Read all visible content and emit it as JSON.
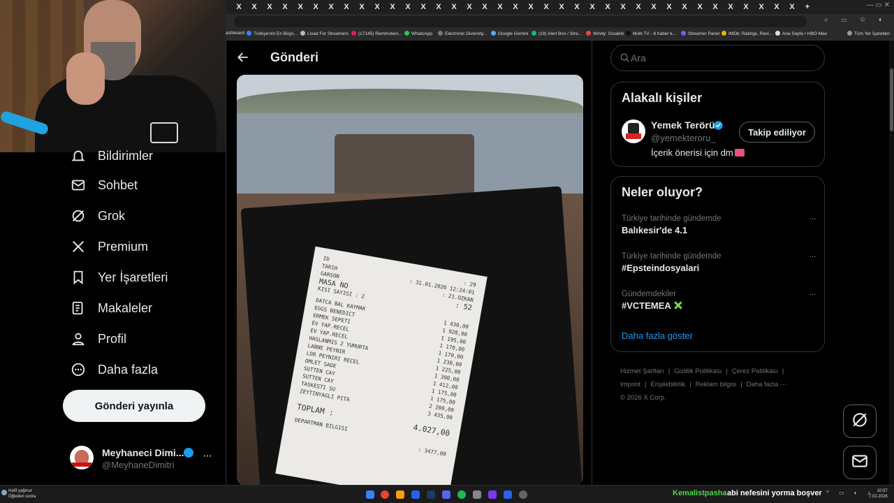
{
  "browser": {
    "tab_close_glyph": "X",
    "bookmarks": [
      {
        "label": "ashboard",
        "color": "#888"
      },
      {
        "label": "Türkiye'nin En Büyü...",
        "color": "#3b82f6"
      },
      {
        "label": "Livad For Streamers",
        "color": "#bbb"
      },
      {
        "label": "(17145) Rammstein...",
        "color": "#e11d48"
      },
      {
        "label": "WhatsApp",
        "color": "#22c55e"
      },
      {
        "label": "Electronic Diversity...",
        "color": "#777"
      },
      {
        "label": "Google Gemini",
        "color": "#60a5fa"
      },
      {
        "label": "(19) Alert Box / Stre...",
        "color": "#10b981"
      },
      {
        "label": "Windy: Sıcaklık",
        "color": "#ef4444"
      },
      {
        "label": "Multi TV - 6 haber k...",
        "color": "#111"
      },
      {
        "label": "Streamer Panel",
        "color": "#6366f1"
      },
      {
        "label": "IMDb: Ratings, Revi...",
        "color": "#eab308"
      },
      {
        "label": "Ana Sayfa • HBO Max",
        "color": "#ddd"
      },
      {
        "label": "Tüm Yer İşaretleri",
        "color": "#999"
      }
    ]
  },
  "nav": {
    "items": [
      {
        "label": "Bildirimler",
        "icon": "bell-icon"
      },
      {
        "label": "Sohbet",
        "icon": "mail-icon"
      },
      {
        "label": "Grok",
        "icon": "grok-icon"
      },
      {
        "label": "Premium",
        "icon": "x-logo-icon"
      },
      {
        "label": "Yer İşaretleri",
        "icon": "bookmark-icon"
      },
      {
        "label": "Makaleler",
        "icon": "article-icon"
      },
      {
        "label": "Profil",
        "icon": "profile-icon"
      },
      {
        "label": "Daha fazla",
        "icon": "more-circle-icon"
      }
    ],
    "post_button": "Gönderi yayınla",
    "account": {
      "name": "Meyhaneci Dimi...",
      "handle": "@MeyhaneDimitri",
      "more": "···",
      "avatar_text": "DIMITR"
    }
  },
  "main": {
    "title": "Gönderi",
    "receipt": {
      "header": [
        [
          "ID",
          ": 29"
        ],
        [
          "TARIH",
          ": 31.01.2026 12:24:01"
        ],
        [
          "GARSON",
          ": 21.OZKAN"
        ],
        [
          "MASA NO",
          ": 52"
        ],
        [
          "KISI SAYISI : 2",
          ""
        ]
      ],
      "items": [
        [
          "DATCA BAL KAYMAK",
          "1  430,00"
        ],
        [
          "EGGS BENEDICT",
          "1  920,00"
        ],
        [
          "ERMEK SEPETI",
          "1  195,00"
        ],
        [
          "EV YAP.RECEL",
          "1  170,00"
        ],
        [
          "EV YAP.RECEL",
          "1  170,00"
        ],
        [
          "HASLANMIS 2 YUMURTA",
          "1  230,00"
        ],
        [
          "LABNE PEYNIR",
          "1  225,00"
        ],
        [
          "LOR PEYNIRI RECEL",
          "1  390,00"
        ],
        [
          "OMLET SADE",
          "1  412,00"
        ],
        [
          "SUTTEN CAY",
          "1  175,00"
        ],
        [
          "SUTTEN CAY",
          "1  175,00"
        ],
        [
          "TASKESTI SU",
          "2  200,00"
        ],
        [
          "ZEYTINYAGLI PITA",
          "3  435,00"
        ]
      ],
      "total_label": "TOPLAM :",
      "total_value": "4.027,00",
      "department": "DEPARTMAN BILGISI",
      "department_value": ": 3477,00"
    }
  },
  "right": {
    "search_placeholder": "Ara",
    "related": {
      "title": "Alakalı kişiler",
      "name": "Yemek Terörü",
      "handle": "@yemekteroru_",
      "bio": "İçerik önerisi için dm",
      "follow_label": "Takip ediliyor"
    },
    "trends": {
      "title": "Neler oluyor?",
      "items": [
        {
          "context": "Türkiye tarihinde gündemde",
          "name": "Balıkesir'de 4.1"
        },
        {
          "context": "Türkiye tarihinde gündemde",
          "name": "#Epsteindosyalari"
        },
        {
          "context": "Gündemdekiler",
          "name": "#VCTEMEA"
        }
      ],
      "more_glyph": "···",
      "show_more": "Daha fazla göster"
    },
    "footer": {
      "links": [
        "Hizmet Şartları",
        "Gizlilik Politikası",
        "Çerez Politikası",
        "Imprint",
        "Erişilebilirlik",
        "Reklam bilgisi",
        "Daha fazla ···"
      ],
      "sep": "|",
      "copyright": "© 2026 X Corp."
    }
  },
  "taskbar": {
    "weather_line1": "Hafif yağmur",
    "weather_line2": "Öğleden sonra",
    "chat_user": "Kemalistpasha",
    "chat_message": "abi nefesini yorma boşver",
    "time": "10:57",
    "date": "7.02.2026"
  },
  "colors": {
    "accent": "#1d9bf0",
    "chat_user": "#4fd44f",
    "verified": "#1d9bf0"
  }
}
